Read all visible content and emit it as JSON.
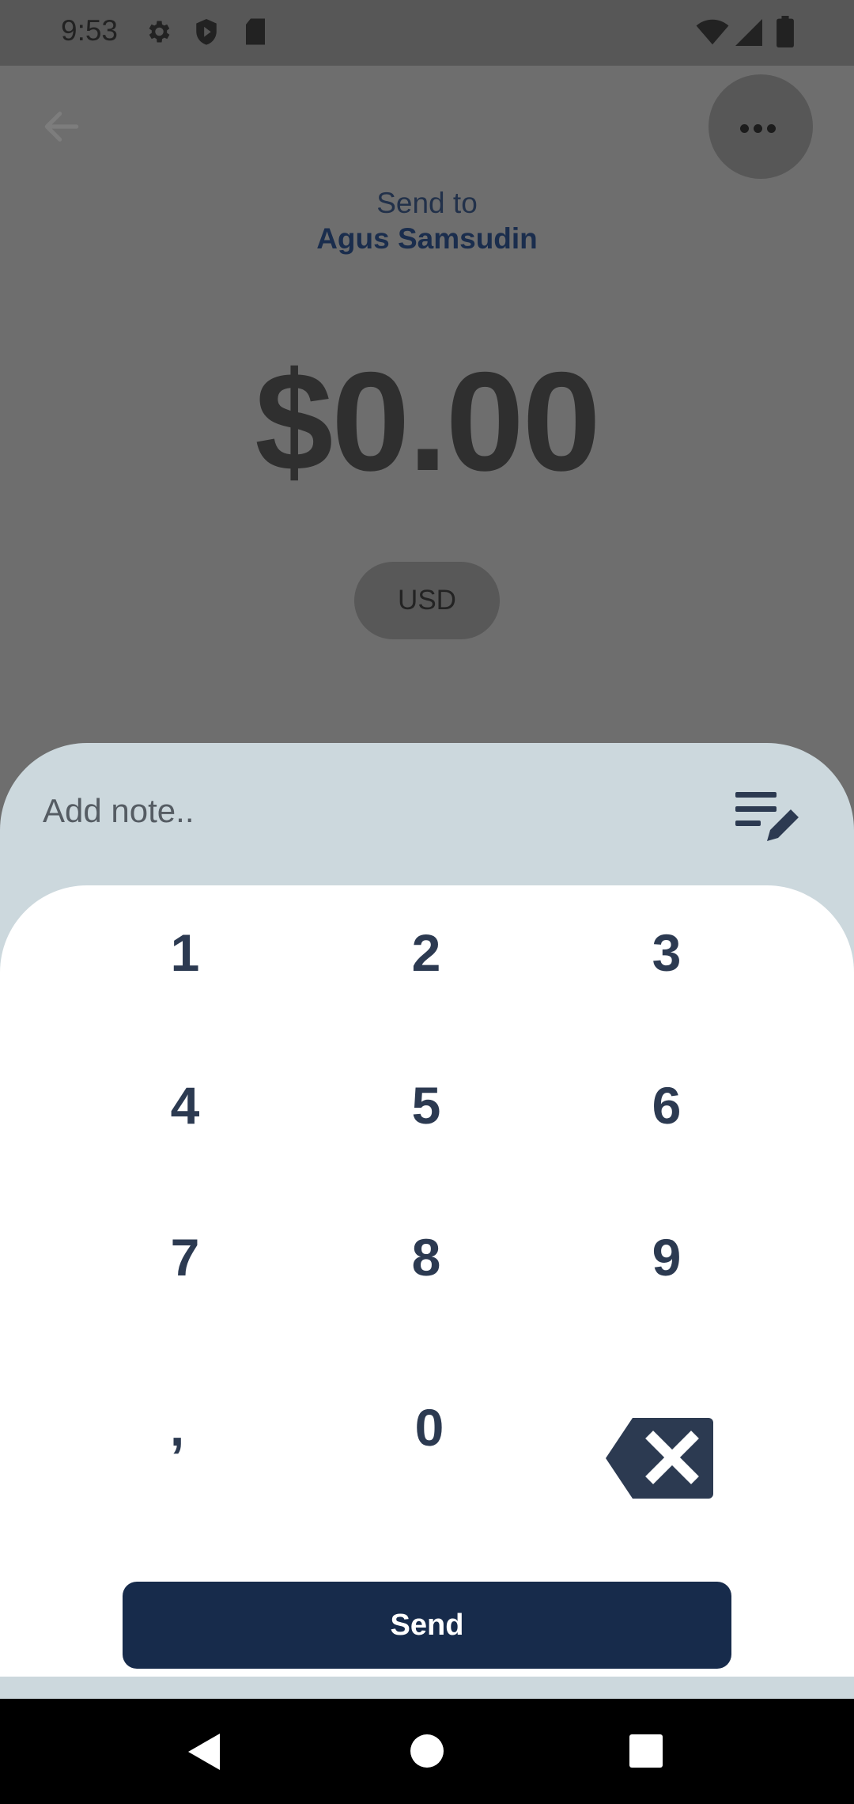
{
  "status_bar": {
    "time": "9:53",
    "left_icons": [
      "gear-icon",
      "shield-icon",
      "sd-card-icon"
    ],
    "right_icons": [
      "wifi-icon",
      "signal-icon",
      "battery-icon"
    ]
  },
  "header": {
    "back_icon": "arrow-left-icon",
    "more_icon": "more-horizontal-icon",
    "send_to_label": "Send to",
    "recipient": "Agus Samsudin"
  },
  "amount": {
    "value": "$0.00",
    "currency": "USD"
  },
  "note": {
    "placeholder": "Add note..",
    "icon": "edit-note-icon"
  },
  "keypad": {
    "keys": [
      "1",
      "2",
      "3",
      "4",
      "5",
      "6",
      "7",
      "8",
      "9",
      ",",
      "0"
    ],
    "backspace_icon": "backspace-icon"
  },
  "send_button": {
    "label": "Send"
  },
  "colors": {
    "overlay": "#6e6e6e",
    "sheet": "#ccd8dd",
    "keypad_bg": "#ffffff",
    "primary": "#172b4b",
    "key_text": "#2c3a51"
  }
}
